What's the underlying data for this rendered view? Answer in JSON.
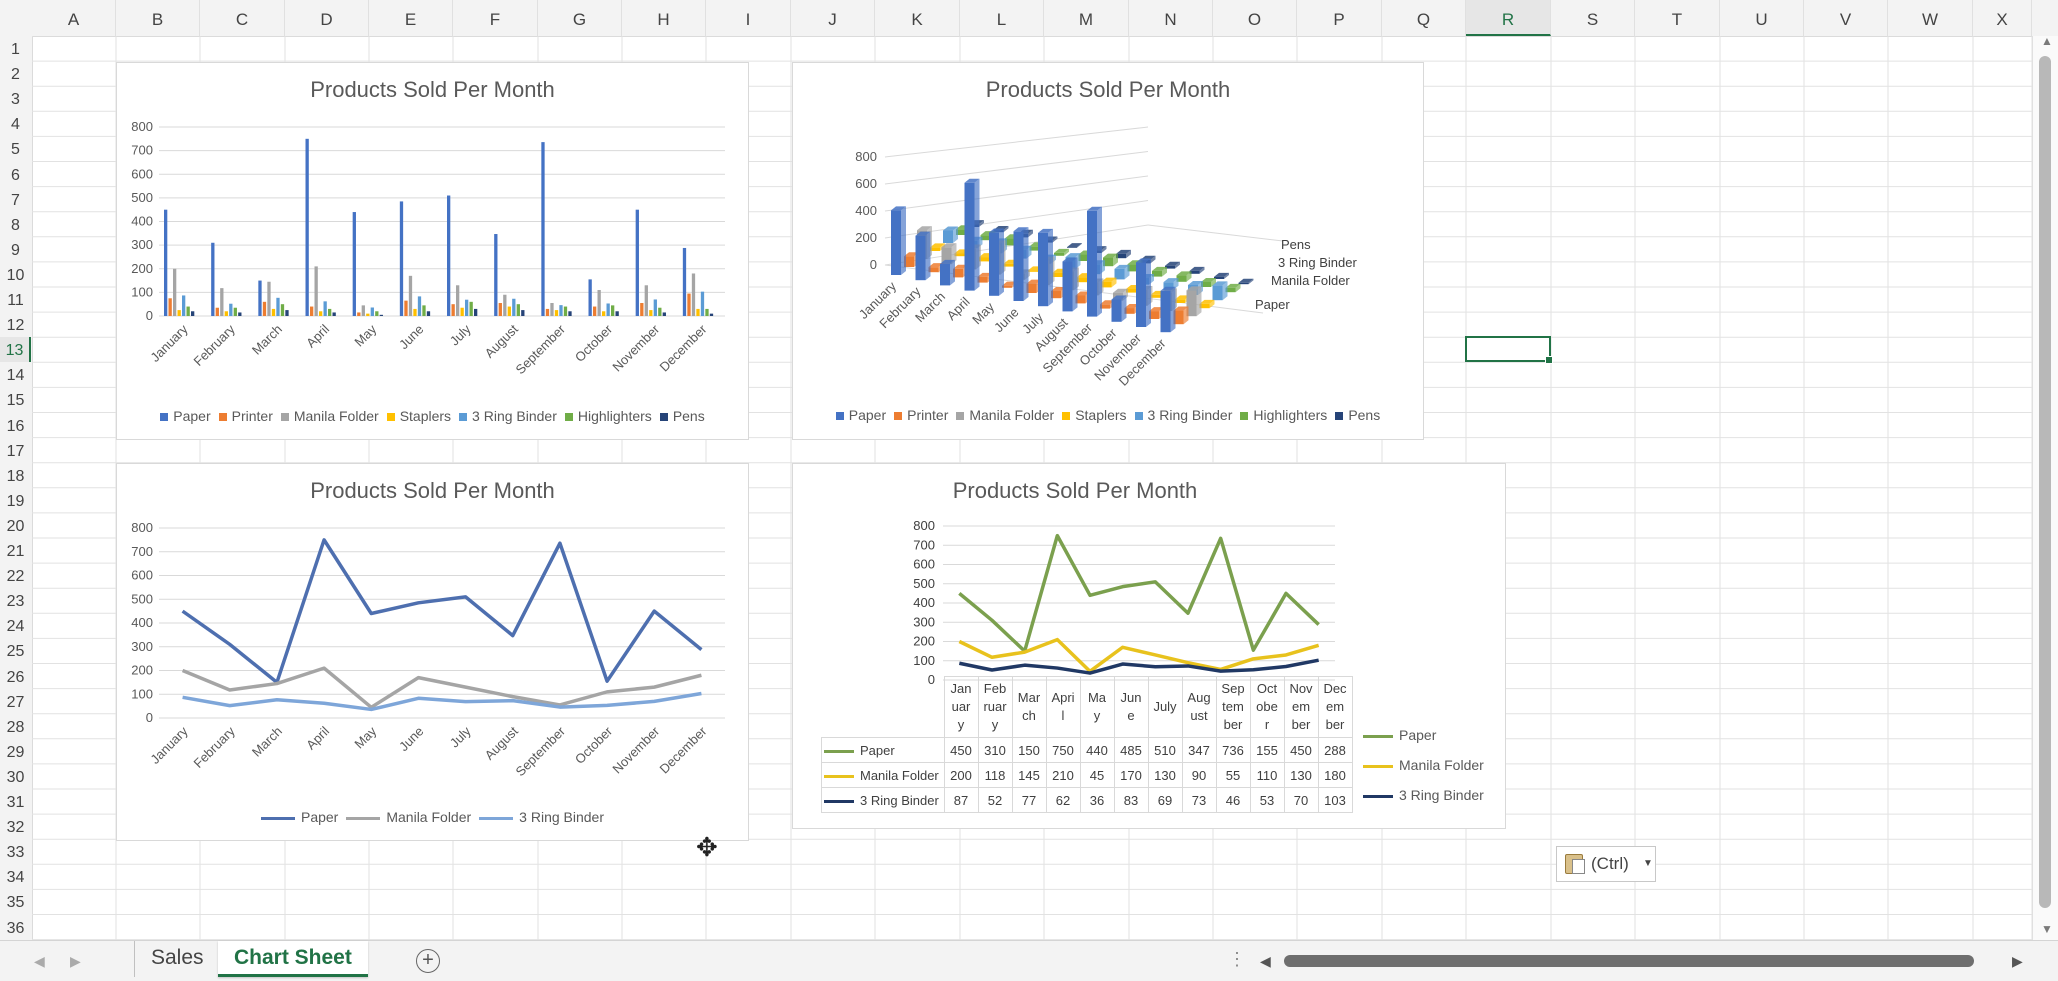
{
  "columns": [
    "A",
    "B",
    "C",
    "D",
    "E",
    "F",
    "G",
    "H",
    "I",
    "J",
    "K",
    "L",
    "M",
    "N",
    "O",
    "P",
    "Q",
    "R",
    "S",
    "T",
    "U",
    "V",
    "W",
    "X"
  ],
  "rows": [
    "1",
    "2",
    "3",
    "4",
    "5",
    "6",
    "7",
    "8",
    "9",
    "10",
    "11",
    "12",
    "13",
    "14",
    "15",
    "16",
    "17",
    "18",
    "19",
    "20",
    "21",
    "22",
    "23",
    "24",
    "25",
    "26",
    "27",
    "28",
    "29",
    "30",
    "31",
    "32",
    "33",
    "34",
    "35",
    "36"
  ],
  "selected_cell": {
    "col": "R",
    "row": "13"
  },
  "chart_title": "Products Sold Per Month",
  "months": [
    "January",
    "February",
    "March",
    "April",
    "May",
    "June",
    "July",
    "August",
    "September",
    "October",
    "November",
    "December"
  ],
  "month_abbrev_rows": [
    [
      "Jan",
      "uar",
      "y"
    ],
    [
      "Feb",
      "ruar",
      "y"
    ],
    [
      "Mar",
      "ch"
    ],
    [
      "Apri",
      "l"
    ],
    [
      "Ma",
      "y"
    ],
    [
      "Jun",
      "e"
    ],
    [
      "July"
    ],
    [
      "Aug",
      "ust"
    ],
    [
      "Sep",
      "tem",
      "ber"
    ],
    [
      "Oct",
      "obe",
      "r"
    ],
    [
      "Nov",
      "em",
      "ber"
    ],
    [
      "Dec",
      "em",
      "ber"
    ]
  ],
  "series_colors": {
    "Paper": "#4472C4",
    "Printer": "#ED7D31",
    "Manila Folder": "#A5A5A5",
    "Staplers": "#FFC000",
    "3 Ring Binder": "#5B9BD5",
    "Highlighters": "#70AD47",
    "Pens": "#264478"
  },
  "chart_data": [
    {
      "type": "bar",
      "title": "Products Sold Per Month",
      "categories": [
        "January",
        "February",
        "March",
        "April",
        "May",
        "June",
        "July",
        "August",
        "September",
        "October",
        "November",
        "December"
      ],
      "ylim": [
        0,
        800
      ],
      "yticks": [
        0,
        100,
        200,
        300,
        400,
        500,
        600,
        700,
        800
      ],
      "legend_position": "bottom",
      "series": [
        {
          "name": "Paper",
          "values": [
            450,
            310,
            150,
            750,
            440,
            485,
            510,
            347,
            736,
            155,
            450,
            288
          ]
        },
        {
          "name": "Printer",
          "values": [
            75,
            35,
            60,
            40,
            15,
            65,
            50,
            55,
            30,
            40,
            55,
            95
          ]
        },
        {
          "name": "Manila Folder",
          "values": [
            200,
            118,
            145,
            210,
            45,
            170,
            130,
            90,
            55,
            110,
            130,
            180
          ]
        },
        {
          "name": "Staplers",
          "values": [
            25,
            20,
            30,
            20,
            10,
            30,
            35,
            40,
            25,
            20,
            25,
            30
          ]
        },
        {
          "name": "3 Ring Binder",
          "values": [
            87,
            52,
            77,
            62,
            36,
            83,
            69,
            73,
            46,
            53,
            70,
            103
          ]
        },
        {
          "name": "Highlighters",
          "values": [
            40,
            35,
            50,
            30,
            20,
            45,
            60,
            50,
            40,
            45,
            35,
            30
          ]
        },
        {
          "name": "Pens",
          "values": [
            20,
            15,
            25,
            15,
            5,
            20,
            30,
            25,
            20,
            20,
            15,
            10
          ]
        }
      ]
    },
    {
      "type": "bar",
      "subtype": "3d-column",
      "title": "Products Sold Per Month",
      "categories": [
        "January",
        "February",
        "March",
        "April",
        "May",
        "June",
        "July",
        "August",
        "September",
        "October",
        "November",
        "December"
      ],
      "ylim": [
        0,
        800
      ],
      "yticks": [
        0,
        200,
        400,
        600,
        800
      ],
      "depth_labels": [
        "Paper",
        "Manila Folder",
        "3 Ring Binder",
        "Pens"
      ],
      "legend_position": "bottom",
      "series": [
        {
          "name": "Paper",
          "values": [
            450,
            310,
            150,
            750,
            440,
            485,
            510,
            347,
            736,
            155,
            450,
            288
          ]
        },
        {
          "name": "Printer",
          "values": [
            75,
            35,
            60,
            40,
            15,
            65,
            50,
            55,
            30,
            40,
            55,
            95
          ]
        },
        {
          "name": "Manila Folder",
          "values": [
            200,
            118,
            145,
            210,
            45,
            170,
            130,
            90,
            55,
            110,
            130,
            180
          ]
        },
        {
          "name": "Staplers",
          "values": [
            25,
            20,
            30,
            20,
            10,
            30,
            35,
            40,
            25,
            20,
            25,
            30
          ]
        },
        {
          "name": "3 Ring Binder",
          "values": [
            87,
            52,
            77,
            62,
            36,
            83,
            69,
            73,
            46,
            53,
            70,
            103
          ]
        },
        {
          "name": "Highlighters",
          "values": [
            40,
            35,
            50,
            30,
            20,
            45,
            60,
            50,
            40,
            45,
            35,
            30
          ]
        },
        {
          "name": "Pens",
          "values": [
            20,
            15,
            25,
            15,
            5,
            20,
            30,
            25,
            20,
            20,
            15,
            10
          ]
        }
      ]
    },
    {
      "type": "line",
      "title": "Products Sold Per Month",
      "categories": [
        "January",
        "February",
        "March",
        "April",
        "May",
        "June",
        "July",
        "August",
        "September",
        "October",
        "November",
        "December"
      ],
      "ylim": [
        0,
        800
      ],
      "yticks": [
        0,
        100,
        200,
        300,
        400,
        500,
        600,
        700,
        800
      ],
      "legend_position": "bottom",
      "series": [
        {
          "name": "Paper",
          "color": "#4E6FAF",
          "values": [
            450,
            310,
            150,
            750,
            440,
            485,
            510,
            347,
            736,
            155,
            450,
            288
          ]
        },
        {
          "name": "Manila Folder",
          "color": "#A5A5A5",
          "values": [
            200,
            118,
            145,
            210,
            45,
            170,
            130,
            90,
            55,
            110,
            130,
            180
          ]
        },
        {
          "name": "3 Ring Binder",
          "color": "#7EA6D9",
          "values": [
            87,
            52,
            77,
            62,
            36,
            83,
            69,
            73,
            46,
            53,
            70,
            103
          ]
        }
      ]
    },
    {
      "type": "line",
      "title": "Products Sold Per Month",
      "with_data_table": true,
      "categories": [
        "January",
        "February",
        "March",
        "April",
        "May",
        "June",
        "July",
        "August",
        "September",
        "October",
        "November",
        "December"
      ],
      "ylim": [
        0,
        800
      ],
      "yticks": [
        0,
        100,
        200,
        300,
        400,
        500,
        600,
        700,
        800
      ],
      "legend_position": "right",
      "series": [
        {
          "name": "Paper",
          "color": "#7BA04E",
          "values": [
            450,
            310,
            150,
            750,
            440,
            485,
            510,
            347,
            736,
            155,
            450,
            288
          ]
        },
        {
          "name": "Manila Folder",
          "color": "#E8C21D",
          "values": [
            200,
            118,
            145,
            210,
            45,
            170,
            130,
            90,
            55,
            110,
            130,
            180
          ]
        },
        {
          "name": "3 Ring Binder",
          "color": "#203864",
          "values": [
            87,
            52,
            77,
            62,
            36,
            83,
            69,
            73,
            46,
            53,
            70,
            103
          ]
        }
      ]
    }
  ],
  "paste_options": {
    "label": "(Ctrl)",
    "dropdown_icon": "caret-down"
  },
  "sheet_tabs": [
    {
      "label": "Sales",
      "active": false
    },
    {
      "label": "Chart Sheet",
      "active": true
    }
  ],
  "add_sheet_label": "+"
}
